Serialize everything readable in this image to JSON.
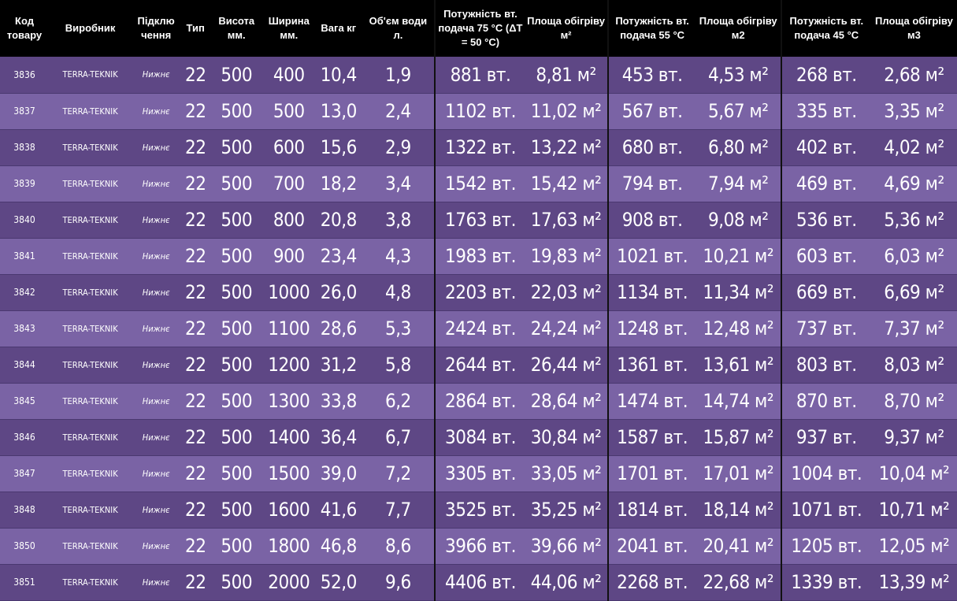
{
  "headers": {
    "code": "Код товару",
    "manufacturer": "Виробник",
    "connection": "Підклю чення",
    "type": "Тип",
    "height": "Висота мм.",
    "width": "Ширина мм.",
    "weight": "Вага кг",
    "volume": "Об'єм води л.",
    "power75": "Потужність вт. подача 75 °С (ΔТ = 50 °С)",
    "area75": "Площа обігріву м²",
    "power55": "Потужність вт. подача 55 °С",
    "area55": "Площа обігріву м2",
    "power45": "Потужність вт. подача 45 °С",
    "area45": "Площа обігріву м3"
  },
  "rows": [
    {
      "code": "3836",
      "manufacturer": "TERRA-TEKNIK",
      "connection": "Нижнє",
      "type": "22",
      "height": "500",
      "width": "400",
      "weight": "10,4",
      "volume": "1,9",
      "power75": "881 вт.",
      "area75": "8,81 м²",
      "power55": "453 вт.",
      "area55": "4,53 м²",
      "power45": "268 вт.",
      "area45": "2,68 м²"
    },
    {
      "code": "3837",
      "manufacturer": "TERRA-TEKNIK",
      "connection": "Нижнє",
      "type": "22",
      "height": "500",
      "width": "500",
      "weight": "13,0",
      "volume": "2,4",
      "power75": "1102 вт.",
      "area75": "11,02 м²",
      "power55": "567 вт.",
      "area55": "5,67 м²",
      "power45": "335 вт.",
      "area45": "3,35 м²"
    },
    {
      "code": "3838",
      "manufacturer": "TERRA-TEKNIK",
      "connection": "Нижнє",
      "type": "22",
      "height": "500",
      "width": "600",
      "weight": "15,6",
      "volume": "2,9",
      "power75": "1322 вт.",
      "area75": "13,22 м²",
      "power55": "680 вт.",
      "area55": "6,80 м²",
      "power45": "402 вт.",
      "area45": "4,02 м²"
    },
    {
      "code": "3839",
      "manufacturer": "TERRA-TEKNIK",
      "connection": "Нижнє",
      "type": "22",
      "height": "500",
      "width": "700",
      "weight": "18,2",
      "volume": "3,4",
      "power75": "1542 вт.",
      "area75": "15,42 м²",
      "power55": "794 вт.",
      "area55": "7,94 м²",
      "power45": "469 вт.",
      "area45": "4,69 м²"
    },
    {
      "code": "3840",
      "manufacturer": "TERRA-TEKNIK",
      "connection": "Нижнє",
      "type": "22",
      "height": "500",
      "width": "800",
      "weight": "20,8",
      "volume": "3,8",
      "power75": "1763 вт.",
      "area75": "17,63 м²",
      "power55": "908 вт.",
      "area55": "9,08 м²",
      "power45": "536 вт.",
      "area45": "5,36 м²"
    },
    {
      "code": "3841",
      "manufacturer": "TERRA-TEKNIK",
      "connection": "Нижнє",
      "type": "22",
      "height": "500",
      "width": "900",
      "weight": "23,4",
      "volume": "4,3",
      "power75": "1983 вт.",
      "area75": "19,83 м²",
      "power55": "1021 вт.",
      "area55": "10,21 м²",
      "power45": "603 вт.",
      "area45": "6,03 м²"
    },
    {
      "code": "3842",
      "manufacturer": "TERRA-TEKNIK",
      "connection": "Нижнє",
      "type": "22",
      "height": "500",
      "width": "1000",
      "weight": "26,0",
      "volume": "4,8",
      "power75": "2203 вт.",
      "area75": "22,03 м²",
      "power55": "1134 вт.",
      "area55": "11,34 м²",
      "power45": "669 вт.",
      "area45": "6,69 м²"
    },
    {
      "code": "3843",
      "manufacturer": "TERRA-TEKNIK",
      "connection": "Нижнє",
      "type": "22",
      "height": "500",
      "width": "1100",
      "weight": "28,6",
      "volume": "5,3",
      "power75": "2424 вт.",
      "area75": "24,24 м²",
      "power55": "1248 вт.",
      "area55": "12,48 м²",
      "power45": "737 вт.",
      "area45": "7,37 м²"
    },
    {
      "code": "3844",
      "manufacturer": "TERRA-TEKNIK",
      "connection": "Нижнє",
      "type": "22",
      "height": "500",
      "width": "1200",
      "weight": "31,2",
      "volume": "5,8",
      "power75": "2644 вт.",
      "area75": "26,44 м²",
      "power55": "1361 вт.",
      "area55": "13,61 м²",
      "power45": "803 вт.",
      "area45": "8,03 м²"
    },
    {
      "code": "3845",
      "manufacturer": "TERRA-TEKNIK",
      "connection": "Нижнє",
      "type": "22",
      "height": "500",
      "width": "1300",
      "weight": "33,8",
      "volume": "6,2",
      "power75": "2864 вт.",
      "area75": "28,64 м²",
      "power55": "1474 вт.",
      "area55": "14,74 м²",
      "power45": "870 вт.",
      "area45": "8,70 м²"
    },
    {
      "code": "3846",
      "manufacturer": "TERRA-TEKNIK",
      "connection": "Нижнє",
      "type": "22",
      "height": "500",
      "width": "1400",
      "weight": "36,4",
      "volume": "6,7",
      "power75": "3084 вт.",
      "area75": "30,84 м²",
      "power55": "1587 вт.",
      "area55": "15,87 м²",
      "power45": "937 вт.",
      "area45": "9,37 м²"
    },
    {
      "code": "3847",
      "manufacturer": "TERRA-TEKNIK",
      "connection": "Нижнє",
      "type": "22",
      "height": "500",
      "width": "1500",
      "weight": "39,0",
      "volume": "7,2",
      "power75": "3305 вт.",
      "area75": "33,05 м²",
      "power55": "1701 вт.",
      "area55": "17,01 м²",
      "power45": "1004 вт.",
      "area45": "10,04 м²"
    },
    {
      "code": "3848",
      "manufacturer": "TERRA-TEKNIK",
      "connection": "Нижнє",
      "type": "22",
      "height": "500",
      "width": "1600",
      "weight": "41,6",
      "volume": "7,7",
      "power75": "3525 вт.",
      "area75": "35,25 м²",
      "power55": "1814 вт.",
      "area55": "18,14 м²",
      "power45": "1071 вт.",
      "area45": "10,71 м²"
    },
    {
      "code": "3850",
      "manufacturer": "TERRA-TEKNIK",
      "connection": "Нижнє",
      "type": "22",
      "height": "500",
      "width": "1800",
      "weight": "46,8",
      "volume": "8,6",
      "power75": "3966 вт.",
      "area75": "39,66 м²",
      "power55": "2041 вт.",
      "area55": "20,41 м²",
      "power45": "1205 вт.",
      "area45": "12,05 м²"
    },
    {
      "code": "3851",
      "manufacturer": "TERRA-TEKNIK",
      "connection": "Нижнє",
      "type": "22",
      "height": "500",
      "width": "2000",
      "weight": "52,0",
      "volume": "9,6",
      "power75": "4406 вт.",
      "area75": "44,06 м²",
      "power55": "2268 вт.",
      "area55": "22,68 м²",
      "power45": "1339 вт.",
      "area45": "13,39 м²"
    }
  ]
}
